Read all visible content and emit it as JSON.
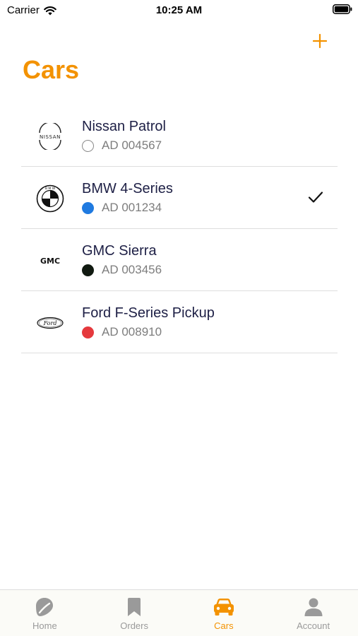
{
  "status_bar": {
    "carrier": "Carrier",
    "time": "10:25 AM"
  },
  "header": {
    "title": "Cars",
    "add_icon": "plus-icon"
  },
  "cars": [
    {
      "name": "Nissan Patrol",
      "plate": "AD 004567",
      "brand": "nissan-logo",
      "color": "#ffffff",
      "selected": false
    },
    {
      "name": "BMW 4-Series",
      "plate": "AD 001234",
      "brand": "bmw-logo",
      "color": "#1f7ae0",
      "selected": true
    },
    {
      "name": "GMC Sierra",
      "plate": "AD 003456",
      "brand": "gmc-logo",
      "color": "#111a11",
      "selected": false
    },
    {
      "name": "Ford F-Series Pickup",
      "plate": "AD 008910",
      "brand": "ford-logo",
      "color": "#e5393d",
      "selected": false
    }
  ],
  "tab_bar": {
    "tabs": [
      {
        "label": "Home",
        "icon": "map-pin-icon",
        "active": false
      },
      {
        "label": "Orders",
        "icon": "bookmark-icon",
        "active": false
      },
      {
        "label": "Cars",
        "icon": "car-icon",
        "active": true
      },
      {
        "label": "Account",
        "icon": "person-icon",
        "active": false
      }
    ]
  },
  "colors": {
    "accent": "#f39200",
    "inactive_tab": "#9a9a9a",
    "title_text": "#1d1f45",
    "secondary_text": "#7d7d7d"
  }
}
